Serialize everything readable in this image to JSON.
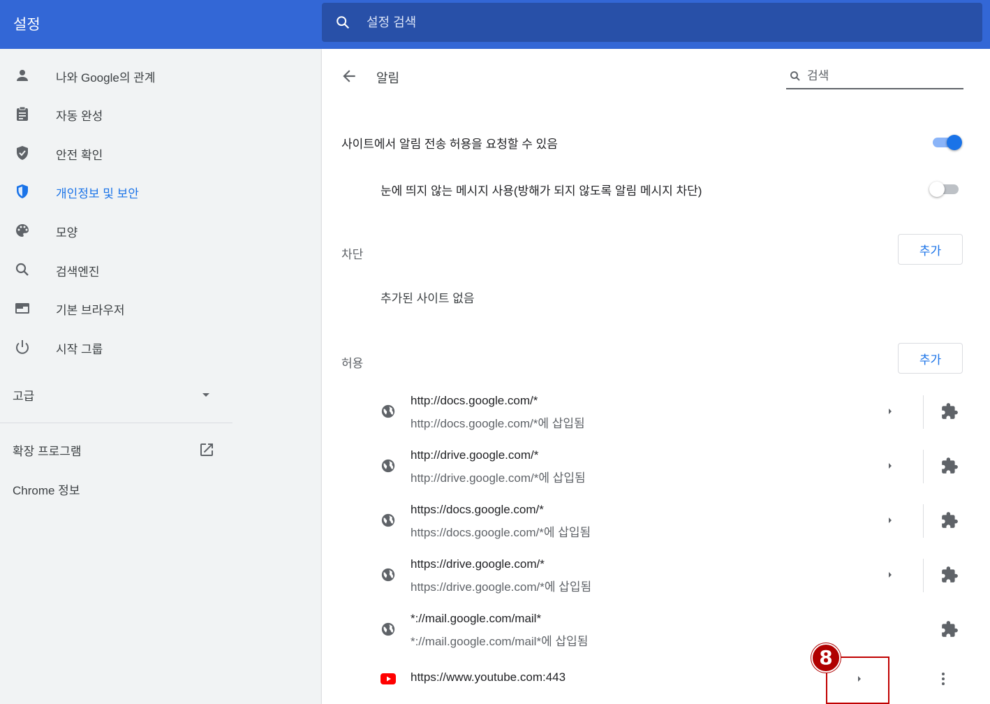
{
  "header": {
    "title": "설정",
    "search_placeholder": "설정 검색"
  },
  "sidebar": {
    "items": [
      {
        "label": "나와 Google의 관계",
        "icon": "person-icon"
      },
      {
        "label": "자동 완성",
        "icon": "clipboard-icon"
      },
      {
        "label": "안전 확인",
        "icon": "shield-check-icon"
      },
      {
        "label": "개인정보 및 보안",
        "icon": "shield-icon",
        "active": true
      },
      {
        "label": "모양",
        "icon": "palette-icon"
      },
      {
        "label": "검색엔진",
        "icon": "search-icon"
      },
      {
        "label": "기본 브라우저",
        "icon": "browser-icon"
      },
      {
        "label": "시작 그룹",
        "icon": "power-icon"
      }
    ],
    "advanced_label": "고급",
    "extensions_label": "확장 프로그램",
    "about_label": "Chrome 정보"
  },
  "main": {
    "title": "알림",
    "search_placeholder": "검색",
    "ask_setting": {
      "label": "사이트에서 알림 전송 허용을 요청할 수 있음",
      "enabled": true
    },
    "quiet_setting": {
      "label": "눈에 띄지 않는 메시지 사용(방해가 되지 않도록 알림 메시지 차단)",
      "enabled": false
    },
    "block": {
      "label": "차단",
      "add_label": "추가",
      "empty_text": "추가된 사이트 없음"
    },
    "allow": {
      "label": "허용",
      "add_label": "추가",
      "sites": [
        {
          "url": "http://docs.google.com/*",
          "sub": "http://docs.google.com/*에 삽입됨"
        },
        {
          "url": "http://drive.google.com/*",
          "sub": "http://drive.google.com/*에 삽입됨"
        },
        {
          "url": "https://docs.google.com/*",
          "sub": "https://docs.google.com/*에 삽입됨"
        },
        {
          "url": "https://drive.google.com/*",
          "sub": "https://drive.google.com/*에 삽입됨"
        },
        {
          "url": "*://mail.google.com/mail*",
          "sub": "*://mail.google.com/mail*에 삽입됨"
        }
      ],
      "youtube": {
        "url": "https://www.youtube.com:443"
      }
    }
  },
  "callout": {
    "number": "8"
  },
  "colors": {
    "header_bg": "#3367d6",
    "search_bg": "#2850a8",
    "accent": "#1a73e8",
    "callout": "#c00000"
  }
}
